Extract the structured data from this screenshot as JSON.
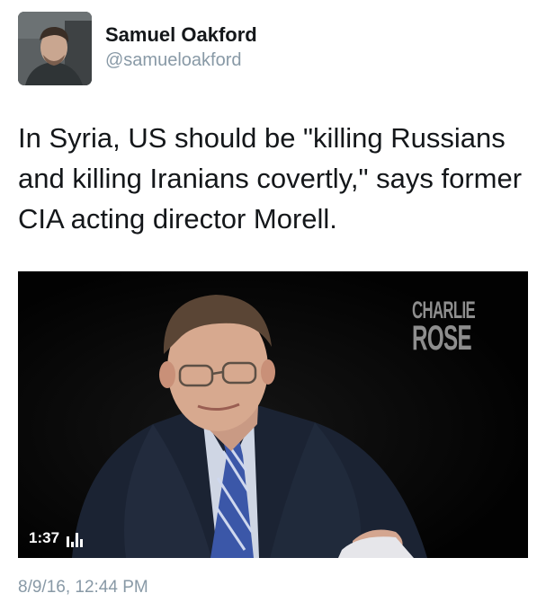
{
  "author": {
    "display_name": "Samuel Oakford",
    "handle": "@samueloakford",
    "avatar_icon": "profile-photo"
  },
  "tweet": {
    "text": "In Syria, US should be \"killing Russians and killing Iranians covertly,\" says former CIA acting director Morell."
  },
  "media": {
    "logo_line1": "CHARLIE",
    "logo_line2": "ROSE",
    "duration": "1:37",
    "stats_icon": "video-stats-icon"
  },
  "timestamp": "8/9/16, 12:44 PM",
  "colors": {
    "text_primary": "#14171a",
    "text_secondary": "#8899a6",
    "video_bg": "#050505"
  }
}
